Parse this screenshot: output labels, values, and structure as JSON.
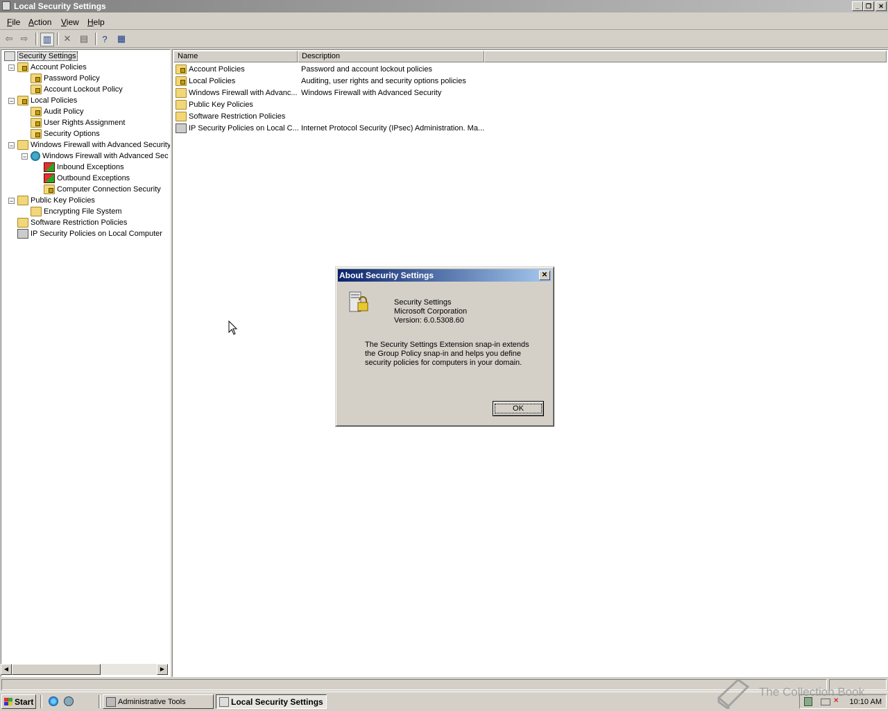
{
  "window": {
    "title": "Local Security Settings"
  },
  "menu": [
    "File",
    "Action",
    "View",
    "Help"
  ],
  "tree": [
    {
      "label": "Security Settings",
      "selected": true,
      "icon": "security-settings-icon"
    },
    {
      "label": "Account Policies",
      "icon": "locked-folder-icon",
      "expander": "−"
    },
    {
      "label": "Password Policy",
      "icon": "locked-folder-icon"
    },
    {
      "label": "Account Lockout Policy",
      "icon": "locked-folder-icon"
    },
    {
      "label": "Local Policies",
      "icon": "locked-folder-icon",
      "expander": "−"
    },
    {
      "label": "Audit Policy",
      "icon": "locked-folder-icon"
    },
    {
      "label": "User Rights Assignment",
      "icon": "locked-folder-icon"
    },
    {
      "label": "Security Options",
      "icon": "locked-folder-icon"
    },
    {
      "label": "Windows Firewall with Advanced Security",
      "icon": "folder-icon",
      "expander": "−"
    },
    {
      "label": "Windows Firewall with Advanced Sec",
      "icon": "firewall-globe-icon",
      "expander": "−"
    },
    {
      "label": "Inbound Exceptions",
      "icon": "firewall-icon"
    },
    {
      "label": "Outbound Exceptions",
      "icon": "firewall-icon"
    },
    {
      "label": "Computer Connection Security",
      "icon": "connection-security-icon"
    },
    {
      "label": "Public Key Policies",
      "icon": "folder-icon",
      "expander": "−"
    },
    {
      "label": "Encrypting File System",
      "icon": "folder-icon"
    },
    {
      "label": "Software Restriction Policies",
      "icon": "folder-icon"
    },
    {
      "label": "IP Security Policies on Local Computer",
      "icon": "ip-security-icon"
    }
  ],
  "list": {
    "columns": [
      "Name",
      "Description"
    ],
    "rows": [
      {
        "name": "Account Policies",
        "description": "Password and account lockout policies",
        "icon": "locked-folder-icon"
      },
      {
        "name": "Local Policies",
        "description": "Auditing, user rights and security options policies",
        "icon": "locked-folder-icon"
      },
      {
        "name": "Windows Firewall with Advanc...",
        "description": "Windows Firewall with Advanced Security",
        "icon": "folder-icon"
      },
      {
        "name": "Public Key Policies",
        "description": "",
        "icon": "folder-icon"
      },
      {
        "name": "Software Restriction Policies",
        "description": "",
        "icon": "folder-icon"
      },
      {
        "name": "IP Security Policies on Local C...",
        "description": "Internet Protocol Security (IPsec) Administration. Ma...",
        "icon": "ip-security-icon"
      }
    ]
  },
  "dialog": {
    "title": "About Security Settings",
    "product": "Security Settings",
    "company": "Microsoft Corporation",
    "version": "Version: 6.0.5308.60",
    "desc1": "The Security Settings Extension snap-in extends",
    "desc2": "the Group Policy snap-in and helps you define",
    "desc3": "security policies for computers in your domain.",
    "ok": "OK"
  },
  "taskbar": {
    "start": "Start",
    "tasks": [
      "Administrative Tools",
      "Local Security Settings"
    ],
    "clock": "10:10 AM"
  },
  "watermark": "The Collection Book"
}
